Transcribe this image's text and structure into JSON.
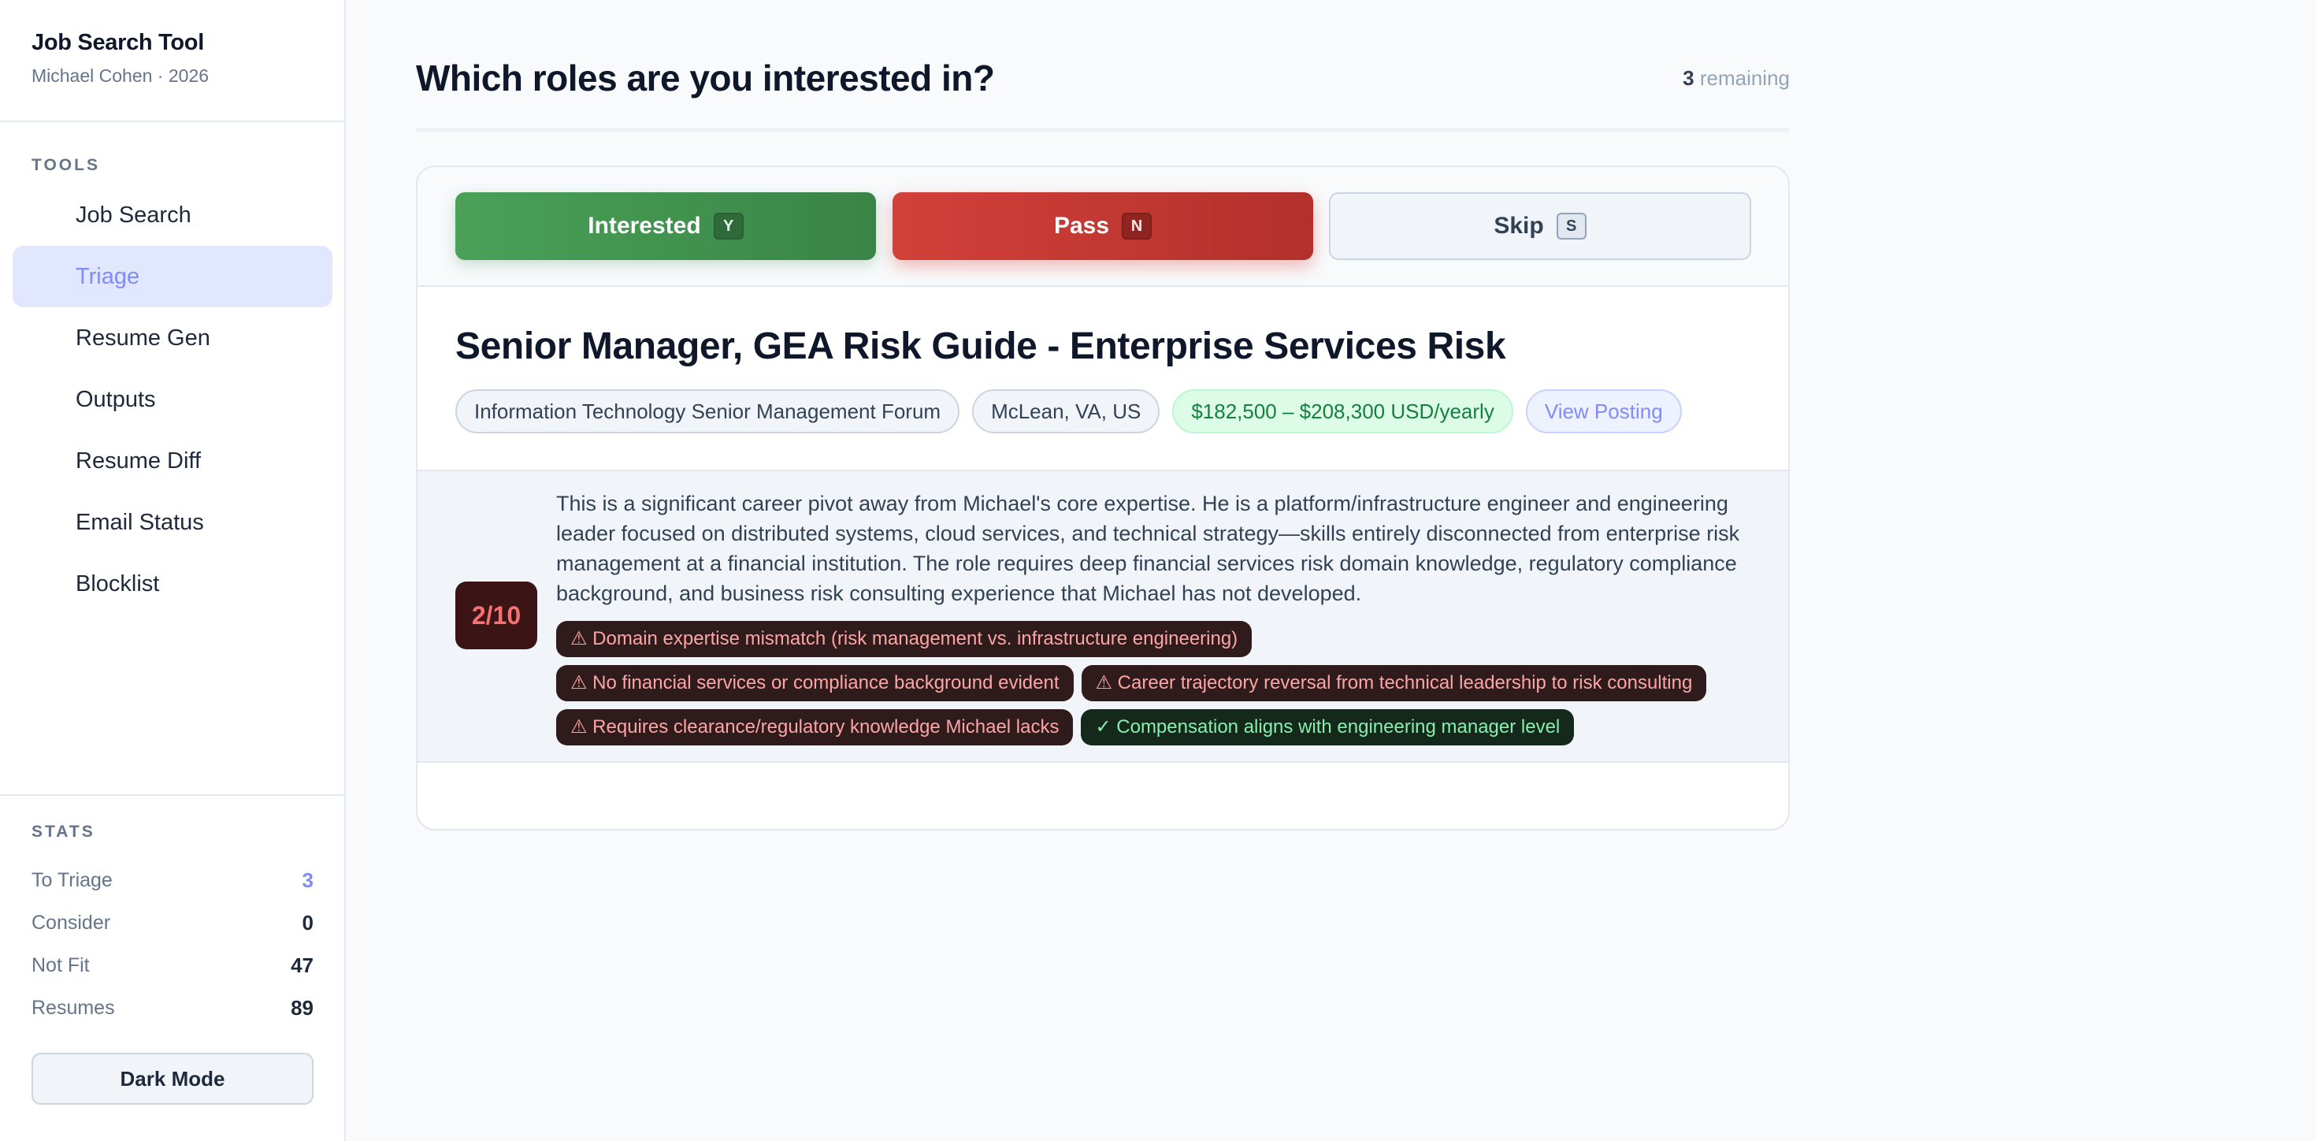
{
  "app": {
    "title": "Job Search Tool",
    "subtitle": "Michael Cohen · 2026"
  },
  "sidebar": {
    "tools_label": "TOOLS",
    "items": [
      {
        "label": "Job Search"
      },
      {
        "label": "Triage",
        "active": true
      },
      {
        "label": "Resume Gen"
      },
      {
        "label": "Outputs"
      },
      {
        "label": "Resume Diff"
      },
      {
        "label": "Email Status"
      },
      {
        "label": "Blocklist"
      }
    ],
    "stats_label": "STATS",
    "stats": [
      {
        "label": "To Triage",
        "value": "3"
      },
      {
        "label": "Consider",
        "value": "0"
      },
      {
        "label": "Not Fit",
        "value": "47"
      },
      {
        "label": "Resumes",
        "value": "89"
      }
    ],
    "dark_mode_label": "Dark Mode"
  },
  "main": {
    "title": "Which roles are you interested in?",
    "remaining_count": "3",
    "remaining_label": "remaining",
    "actions": {
      "interested_label": "Interested",
      "interested_key": "Y",
      "pass_label": "Pass",
      "pass_key": "N",
      "skip_label": "Skip",
      "skip_key": "S"
    },
    "job": {
      "title": "Senior Manager, GEA Risk Guide - Enterprise Services Risk",
      "company": "Information Technology Senior Management Forum",
      "location": "McLean, VA, US",
      "salary": "$182,500 – $208,300 USD/yearly",
      "link_label": "View Posting"
    },
    "analysis": {
      "score": "2/10",
      "summary": "This is a significant career pivot away from Michael's core expertise. He is a platform/infrastructure engineer and engineering leader focused on distributed systems, cloud services, and technical strategy—skills entirely disconnected from enterprise risk management at a financial institution. The role requires deep financial services risk domain knowledge, regulatory compliance background, and business risk consulting experience that Michael has not developed.",
      "tags": [
        {
          "text": "⚠ Domain expertise mismatch (risk management vs. infrastructure engineering)",
          "kind": "bad"
        },
        {
          "text": "⚠ No financial services or compliance background evident",
          "kind": "bad"
        },
        {
          "text": "⚠ Career trajectory reversal from technical leadership to risk consulting",
          "kind": "bad"
        },
        {
          "text": "⚠ Requires clearance/regulatory knowledge Michael lacks",
          "kind": "bad"
        },
        {
          "text": "✓ Compensation aligns with engineering manager level",
          "kind": "good"
        }
      ]
    }
  },
  "colors": {
    "accent": "#818cf8",
    "interested": "#43975a",
    "pass": "#c83a34",
    "score_bad": "#f87171"
  }
}
